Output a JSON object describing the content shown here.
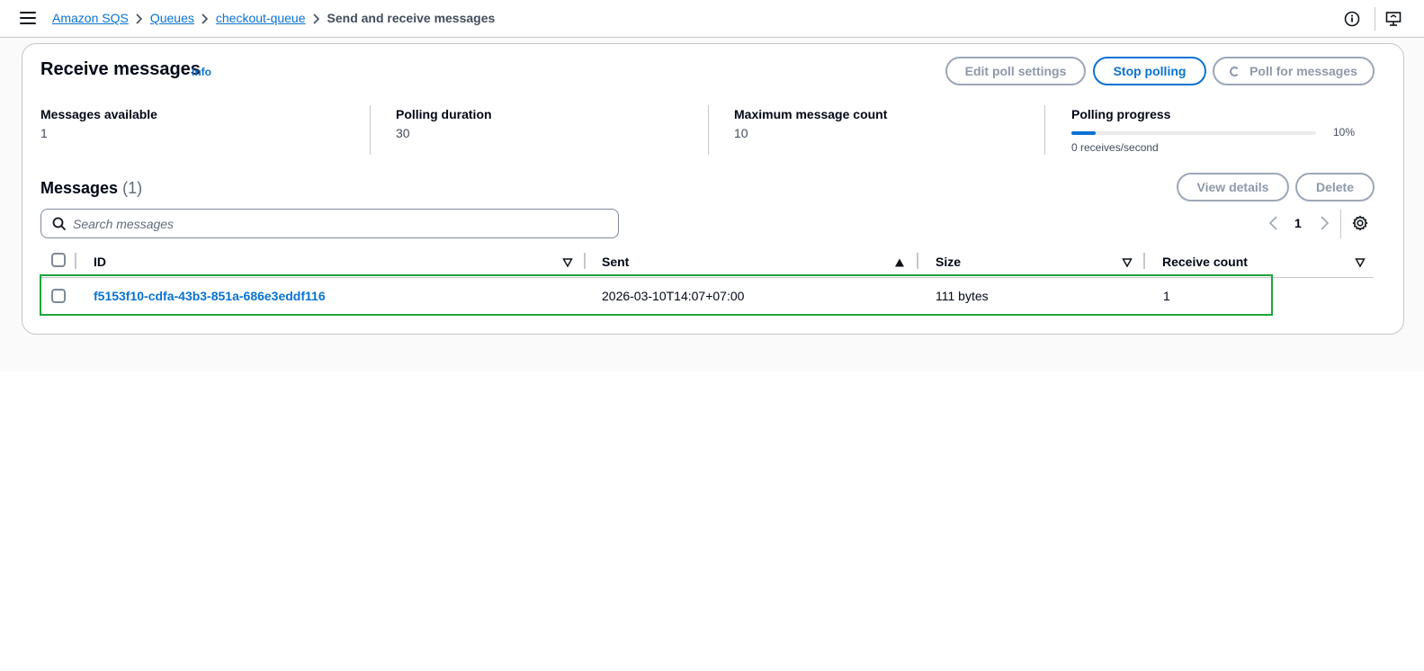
{
  "breadcrumb": {
    "items": [
      "Amazon SQS",
      "Queues",
      "checkout-queue"
    ],
    "current": "Send and receive messages"
  },
  "receive": {
    "title": "Receive messages",
    "info": "Info",
    "buttons": {
      "edit_poll": "Edit poll settings",
      "stop_polling": "Stop polling",
      "poll_messages": "Poll for messages"
    }
  },
  "stats": {
    "available_label": "Messages available",
    "available_value": "1",
    "duration_label": "Polling duration",
    "duration_value": "30",
    "max_label": "Maximum message count",
    "max_value": "10",
    "progress_label": "Polling progress",
    "progress_percent": 10,
    "progress_text": "10%",
    "progress_sub": "0 receives/second"
  },
  "messages": {
    "title": "Messages",
    "count": "(1)",
    "buttons": {
      "view_details": "View details",
      "delete": "Delete"
    },
    "search_placeholder": "Search messages",
    "page": "1",
    "columns": [
      "ID",
      "Sent",
      "Size",
      "Receive count"
    ],
    "rows": [
      {
        "id": "f5153f10-cdfa-43b3-851a-686e3eddf116",
        "sent": "2026-03-10T14:07+07:00",
        "size": "111 bytes",
        "receive_count": "1"
      }
    ]
  },
  "colors": {
    "accent": "#0972d3",
    "highlight": "#1da538",
    "border": "#c6c6cd"
  }
}
